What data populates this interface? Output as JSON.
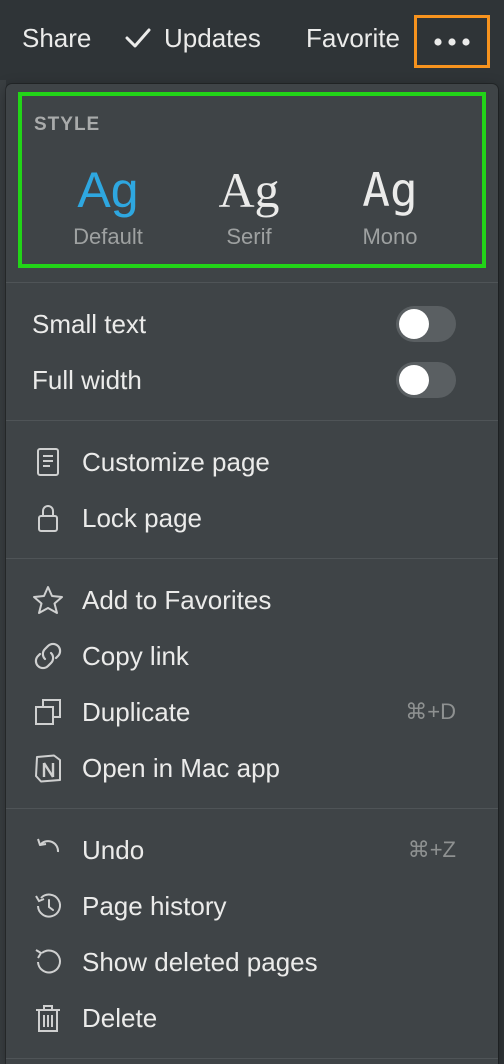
{
  "topbar": {
    "share_label": "Share",
    "updates_label": "Updates",
    "favorite_label": "Favorite"
  },
  "menu": {
    "style": {
      "label": "STYLE",
      "options": [
        {
          "glyph": "Ag",
          "caption": "Default",
          "selected": true
        },
        {
          "glyph": "Ag",
          "caption": "Serif",
          "selected": false
        },
        {
          "glyph": "Ag",
          "caption": "Mono",
          "selected": false
        }
      ]
    },
    "toggles": [
      {
        "label": "Small text",
        "on": false
      },
      {
        "label": "Full width",
        "on": false
      }
    ],
    "page_items": [
      {
        "label": "Customize page",
        "icon": "document-icon"
      },
      {
        "label": "Lock page",
        "icon": "lock-icon"
      }
    ],
    "actions": [
      {
        "label": "Add to Favorites",
        "icon": "star-icon",
        "shortcut": ""
      },
      {
        "label": "Copy link",
        "icon": "link-icon",
        "shortcut": ""
      },
      {
        "label": "Duplicate",
        "icon": "duplicate-icon",
        "shortcut": "⌘+D"
      },
      {
        "label": "Open in Mac app",
        "icon": "notion-icon",
        "shortcut": ""
      }
    ],
    "history": [
      {
        "label": "Undo",
        "icon": "undo-icon",
        "shortcut": "⌘+Z"
      },
      {
        "label": "Page history",
        "icon": "history-icon",
        "shortcut": ""
      },
      {
        "label": "Show deleted pages",
        "icon": "restore-icon",
        "shortcut": ""
      },
      {
        "label": "Delete",
        "icon": "trash-icon",
        "shortcut": ""
      }
    ]
  },
  "colors": {
    "accent": "#2ea7e0",
    "highlight_green": "#22d418",
    "highlight_orange": "#f7931e"
  }
}
